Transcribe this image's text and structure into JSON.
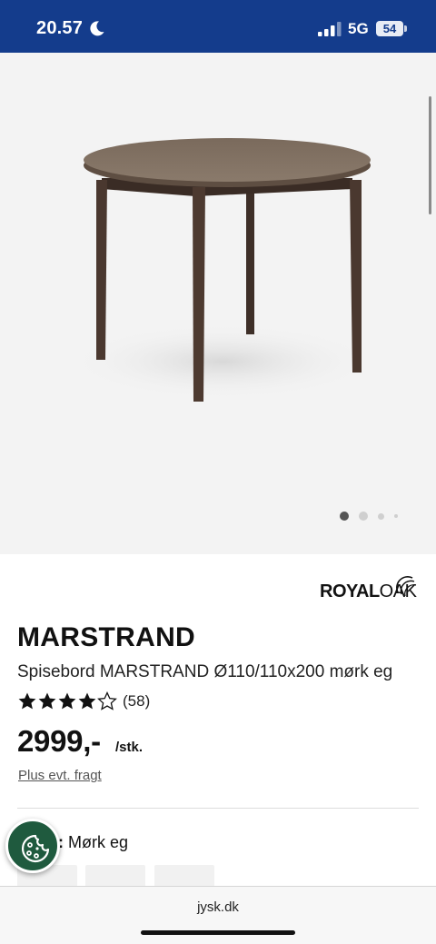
{
  "status_bar": {
    "time": "20.57",
    "network": "5G",
    "battery": "54",
    "icons": [
      "moon-icon",
      "signal-icon",
      "battery-icon"
    ]
  },
  "gallery": {
    "image": "round-dining-table-dark-oak",
    "slides_total": 4,
    "active_slide": 1
  },
  "product": {
    "brand_bold": "ROYAL",
    "brand_light": "OAK",
    "title": "MARSTRAND",
    "subtitle": "Spisebord MARSTRAND Ø110/110x200 mørk eg",
    "rating": 4.5,
    "review_count": "(58)",
    "price": "2999,-",
    "price_unit": "/stk.",
    "shipping_note": "Plus evt. fragt",
    "color_prefix": ":",
    "color_value": "Mørk eg"
  },
  "cookie": {
    "icon": "cookie-icon"
  },
  "browser": {
    "url": "jysk.dk"
  }
}
